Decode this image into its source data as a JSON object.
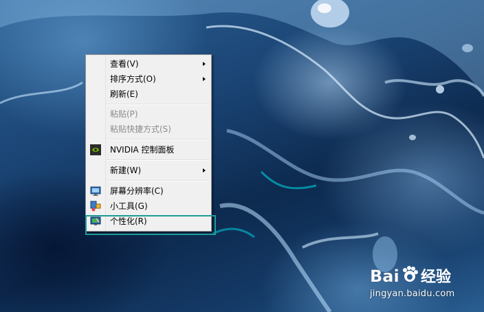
{
  "context_menu": {
    "items": [
      {
        "label": "查看(V)",
        "submenu": true,
        "enabled": true
      },
      {
        "label": "排序方式(O)",
        "submenu": true,
        "enabled": true
      },
      {
        "label": "刷新(E)",
        "submenu": false,
        "enabled": true
      },
      {
        "label": "粘贴(P)",
        "submenu": false,
        "enabled": false
      },
      {
        "label": "粘贴快捷方式(S)",
        "submenu": false,
        "enabled": false
      },
      {
        "label": "NVIDIA 控制面板",
        "submenu": false,
        "enabled": true,
        "icon": "nvidia-icon"
      },
      {
        "label": "新建(W)",
        "submenu": true,
        "enabled": true
      },
      {
        "label": "屏幕分辨率(C)",
        "submenu": false,
        "enabled": true,
        "icon": "monitor-icon"
      },
      {
        "label": "小工具(G)",
        "submenu": false,
        "enabled": true,
        "icon": "gadgets-icon"
      },
      {
        "label": "个性化(R)",
        "submenu": false,
        "enabled": true,
        "icon": "personalize-icon"
      }
    ]
  },
  "highlight": {
    "target": "个性化(R)",
    "color": "#1e9c98"
  },
  "watermark": {
    "logo_text": "Bai经验",
    "url": "jingyan.baidu.com"
  }
}
